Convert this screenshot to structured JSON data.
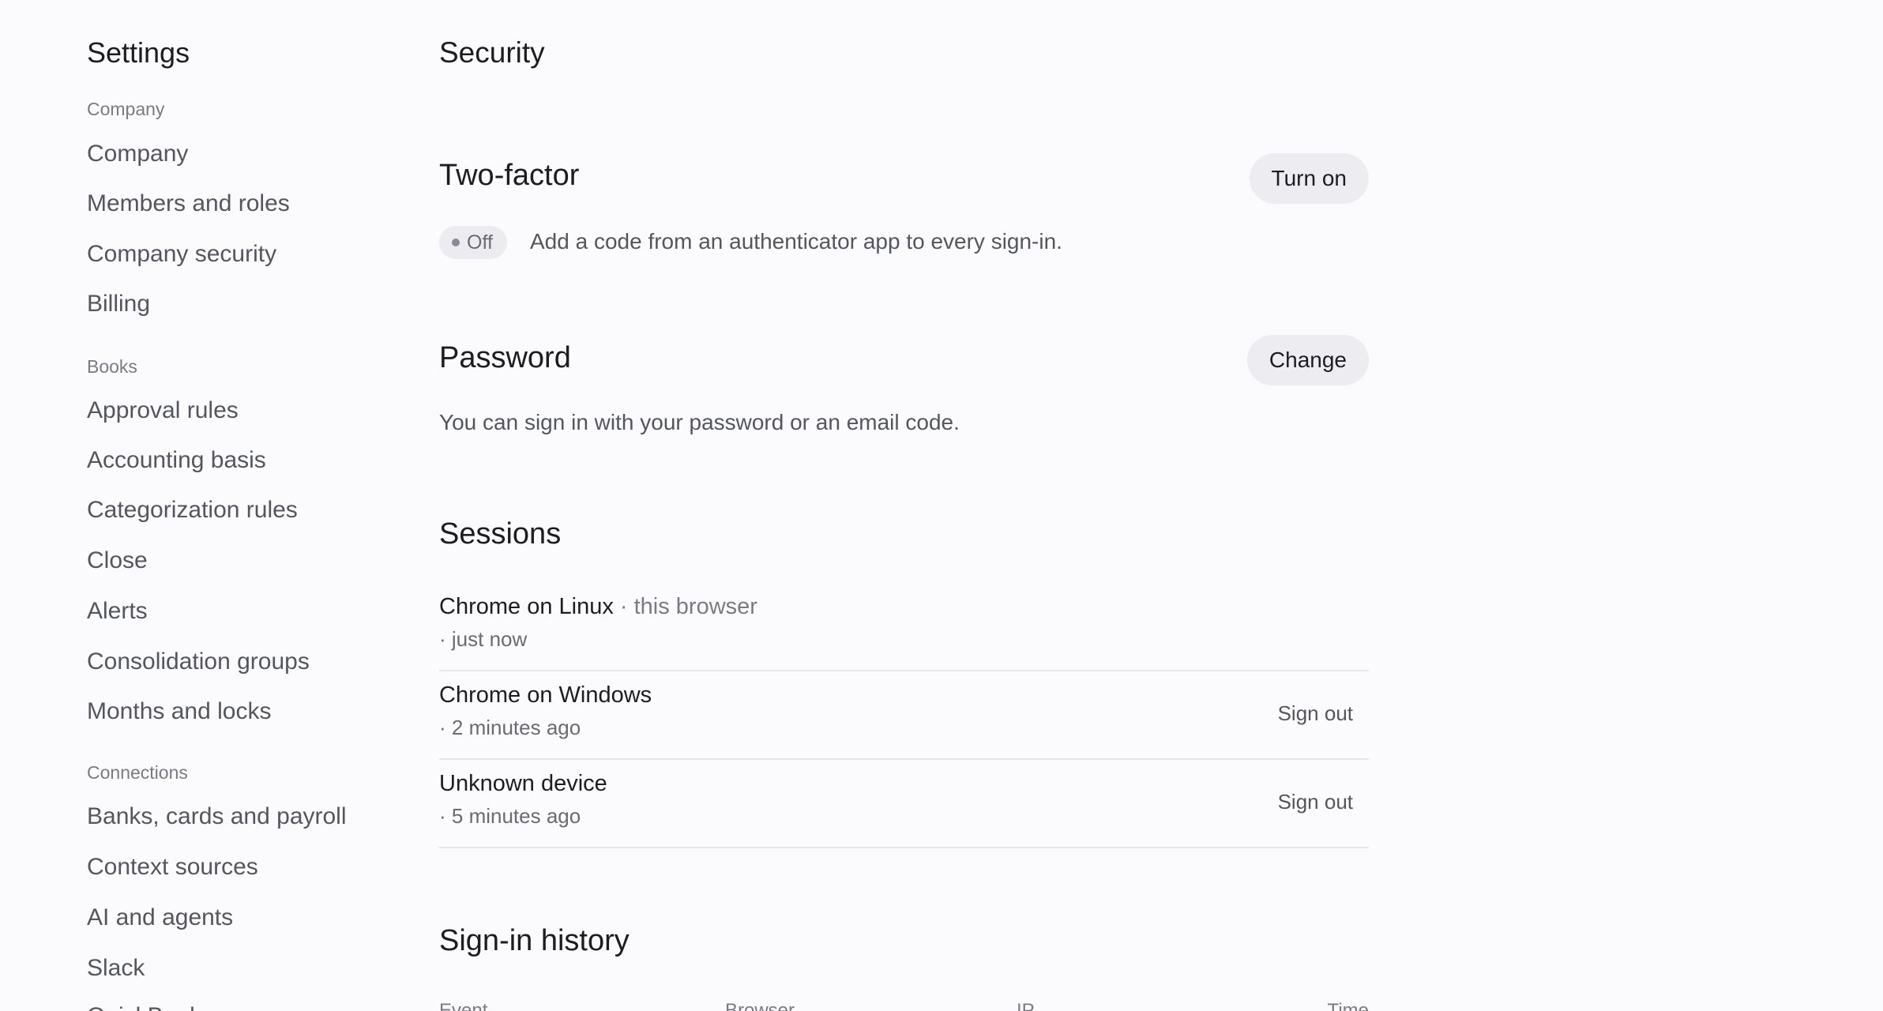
{
  "sidebar": {
    "title": "Settings",
    "groups": [
      {
        "label": "Company",
        "items": [
          "Company",
          "Members and roles",
          "Company security",
          "Billing"
        ]
      },
      {
        "label": "Books",
        "items": [
          "Approval rules",
          "Accounting basis",
          "Categorization rules",
          "Close",
          "Alerts",
          "Consolidation groups",
          "Months and locks"
        ]
      },
      {
        "label": "Connections",
        "items": [
          "Banks, cards and payroll",
          "Context sources",
          "AI and agents",
          "Slack",
          "QuickBooks sync"
        ]
      }
    ]
  },
  "main": {
    "title": "Security",
    "two_factor": {
      "title": "Two-factor",
      "button": "Turn on",
      "status": "Off",
      "description": "Add a code from an authenticator app to every sign-in."
    },
    "password": {
      "title": "Password",
      "button": "Change",
      "description": "You can sign in with your password or an email code."
    },
    "sessions": {
      "title": "Sessions",
      "rows": [
        {
          "device": "Chrome on Linux",
          "note": " · this browser",
          "time": "· just now",
          "action": ""
        },
        {
          "device": "Chrome on Windows",
          "note": "",
          "time": "· 2 minutes ago",
          "action": "Sign out"
        },
        {
          "device": "Unknown device",
          "note": "",
          "time": "· 5 minutes ago",
          "action": "Sign out"
        }
      ]
    },
    "history": {
      "title": "Sign-in history",
      "columns": [
        "Event",
        "Browser",
        "IP",
        "Time"
      ]
    }
  }
}
